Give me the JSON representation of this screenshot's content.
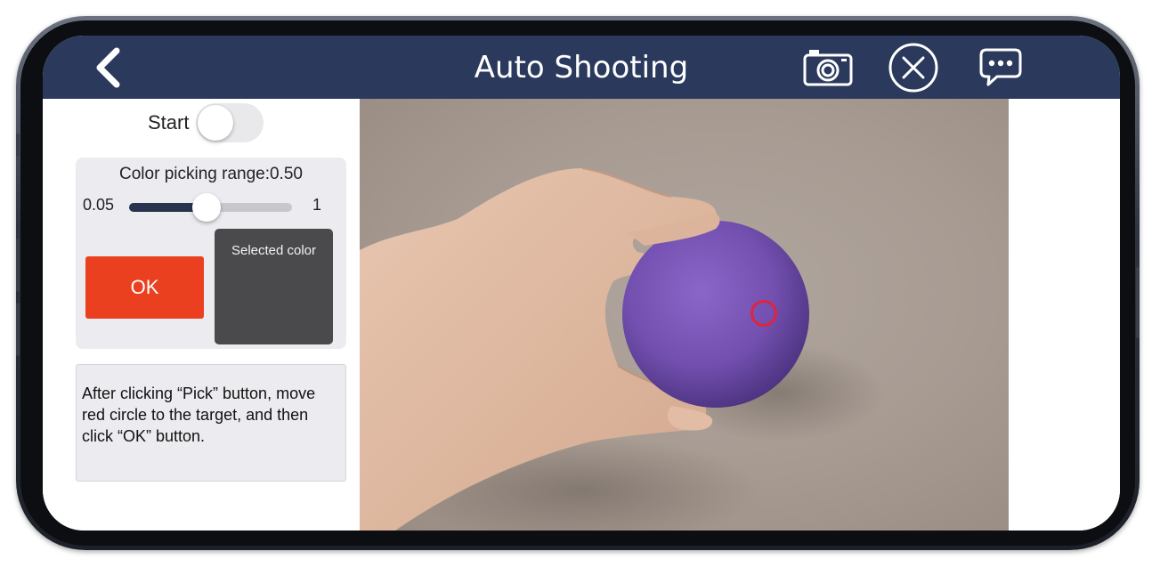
{
  "header": {
    "title": "Auto Shooting",
    "back_icon": "chevron-left-icon",
    "actions": [
      {
        "name": "camera-button",
        "icon": "camera-icon"
      },
      {
        "name": "close-button",
        "icon": "circle-x-icon"
      },
      {
        "name": "chat-button",
        "icon": "chat-bubble-icon"
      }
    ],
    "color": "#2b3a5c"
  },
  "controls": {
    "start_label": "Start",
    "start_on": false,
    "range_label": "Color picking range:0.50",
    "range_min": "0.05",
    "range_max": "1",
    "range_value": 0.5,
    "ok_label": "OK",
    "selected_color_label": "Selected color",
    "selected_color": "#4a4a4c",
    "ok_color": "#ea4020",
    "slider_fill_color": "#26344f"
  },
  "hint": {
    "text": "After clicking “Pick” button, move red circle to the target, and then click “OK” button."
  },
  "camera": {
    "ball_color": "#7a56b8",
    "picker_color": "#e0243a"
  }
}
